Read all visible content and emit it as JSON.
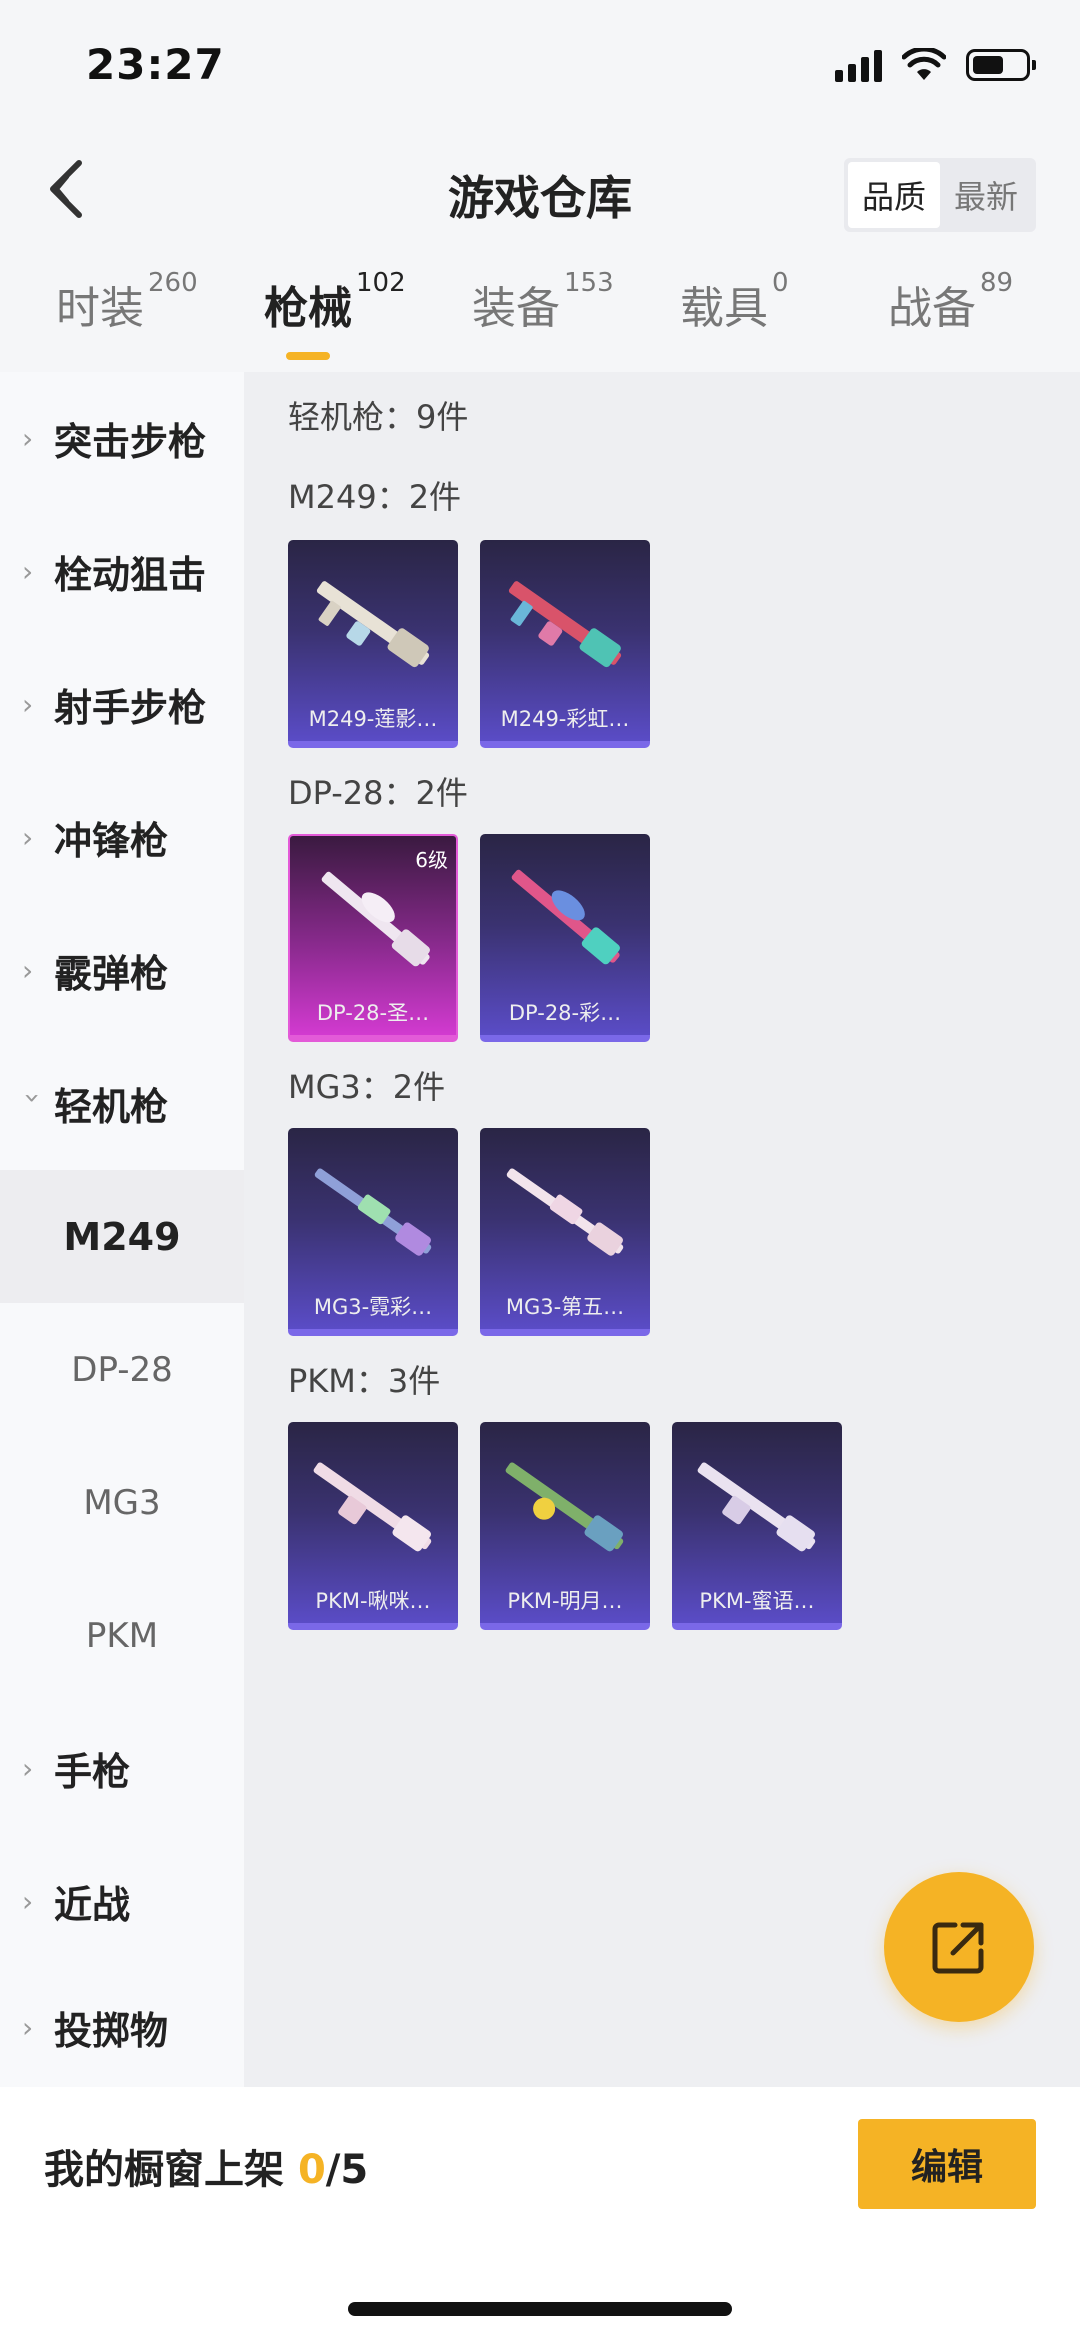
{
  "status": {
    "time": "23:27"
  },
  "header": {
    "title": "游戏仓库",
    "sort_quality": "品质",
    "sort_newest": "最新"
  },
  "tabs": [
    {
      "label": "时装",
      "count": "260"
    },
    {
      "label": "枪械",
      "count": "102"
    },
    {
      "label": "装备",
      "count": "153"
    },
    {
      "label": "载具",
      "count": "0"
    },
    {
      "label": "战备",
      "count": "89"
    }
  ],
  "sidebar": {
    "categories": [
      "突击步枪",
      "栓动狙击",
      "射手步枪",
      "冲锋枪",
      "霰弹枪",
      "轻机枪"
    ],
    "subitems": [
      "M249",
      "DP-28",
      "MG3",
      "PKM"
    ],
    "more": [
      "手枪",
      "近战",
      "投掷物"
    ]
  },
  "content": {
    "total": "轻机枪：9件",
    "groups": [
      {
        "title": "M249：2件",
        "items": [
          {
            "name": "M249-莲影…"
          },
          {
            "name": "M249-彩虹…"
          }
        ]
      },
      {
        "title": "DP-28：2件",
        "items": [
          {
            "name": "DP-28-圣…",
            "level": "6级"
          },
          {
            "name": "DP-28-彩…"
          }
        ]
      },
      {
        "title": "MG3：2件",
        "items": [
          {
            "name": "MG3-霓彩…"
          },
          {
            "name": "MG3-第五…"
          }
        ]
      },
      {
        "title": "PKM：3件",
        "items": [
          {
            "name": "PKM-啾咪…"
          },
          {
            "name": "PKM-明月…"
          },
          {
            "name": "PKM-蜜语…"
          }
        ]
      }
    ]
  },
  "bottom": {
    "label": "我的橱窗上架 ",
    "current": "0",
    "total": "/5",
    "edit": "编辑"
  },
  "colors": {
    "accent": "#f5b325",
    "card_purple": "#5a4cc6",
    "card_pink": "#d23ad0"
  }
}
